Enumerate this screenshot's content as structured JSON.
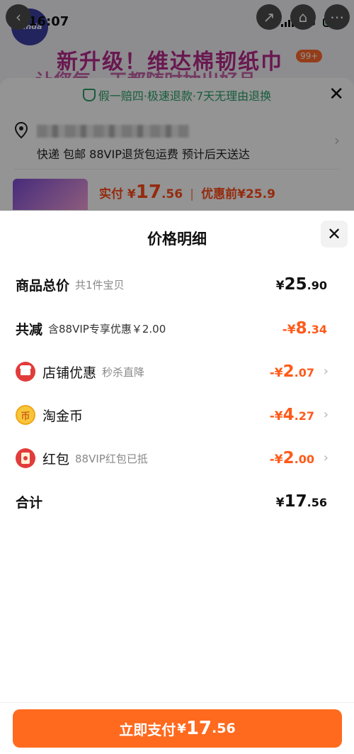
{
  "status_bar": {
    "time": "16:07",
    "network": "5G",
    "logo_text": "Vinda"
  },
  "product_page": {
    "banner_line1": "新升级！维达棉韧纸巾",
    "banner_line2": "让您每一天都随时抽出好品",
    "cart_badge": "99+",
    "guarantee": "假一赔四·极速退款·7天无理由退换",
    "shipping": "快递 包邮 88VIP退货包运费 预计后天送达",
    "paid_label": "实付",
    "paid_currency": "¥",
    "paid_int": "17",
    "paid_dec": ".56",
    "original_label": "优惠前",
    "original_price": "¥25.9"
  },
  "modal": {
    "title": "价格明细",
    "total": {
      "label": "商品总价",
      "sub": "共1件宝贝",
      "currency": "¥",
      "int": "25",
      "dec": ".90"
    },
    "reduction": {
      "label": "共减",
      "sub": "含88VIP专享优惠￥2.00",
      "currency": "-¥",
      "int": "8",
      "dec": ".34"
    },
    "shop_discount": {
      "label": "店铺优惠",
      "sub": "秒杀直降",
      "currency": "-¥",
      "int": "2",
      "dec": ".07"
    },
    "coins": {
      "label": "淘金币",
      "currency": "-¥",
      "int": "4",
      "dec": ".27",
      "icon_glyph": "币"
    },
    "red_packet": {
      "label": "红包",
      "sub": "88VIP红包已抵",
      "currency": "-¥",
      "int": "2",
      "dec": ".00"
    },
    "sum": {
      "label": "合计",
      "currency": "¥",
      "int": "17",
      "dec": ".56"
    }
  },
  "pay_button": {
    "label": "立即支付",
    "currency": "¥",
    "int": "17",
    "dec": ".56"
  },
  "colors": {
    "accent": "#ff5a1a",
    "button": "#ff6a1e",
    "green": "#2aa06a",
    "red_icon": "#e23b3b"
  }
}
